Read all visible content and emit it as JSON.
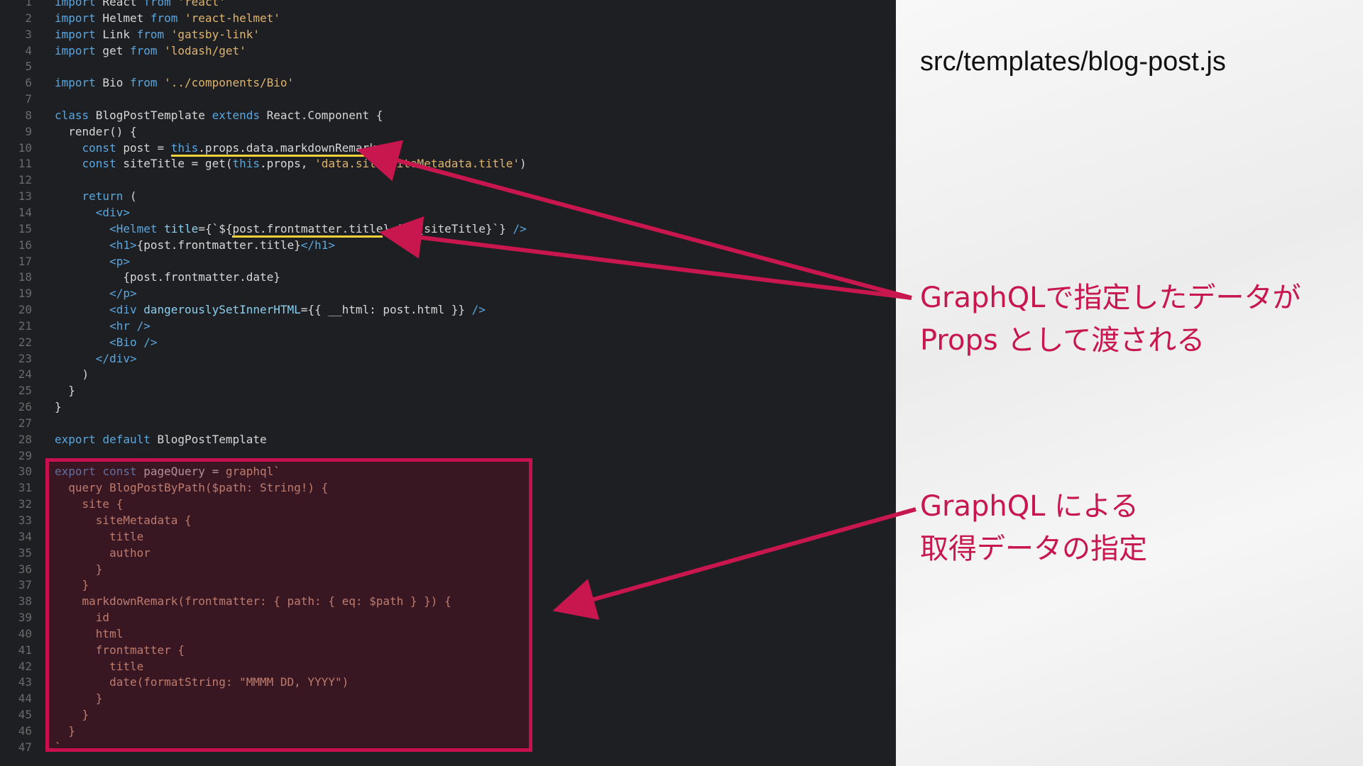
{
  "editor": {
    "lines": [
      {
        "n": "1",
        "html": "<span class=\"kw\">import</span> React <span class=\"kw\">from</span> <span class=\"str\">'react'</span>"
      },
      {
        "n": "2",
        "html": "<span class=\"kw\">import</span> Helmet <span class=\"kw\">from</span> <span class=\"str\">'react-helmet'</span>"
      },
      {
        "n": "3",
        "html": "<span class=\"kw\">import</span> Link <span class=\"kw\">from</span> <span class=\"str\">'gatsby-link'</span>"
      },
      {
        "n": "4",
        "html": "<span class=\"kw\">import</span> get <span class=\"kw\">from</span> <span class=\"str\">'lodash/get'</span>"
      },
      {
        "n": "5",
        "html": ""
      },
      {
        "n": "6",
        "html": "<span class=\"kw\">import</span> Bio <span class=\"kw\">from</span> <span class=\"str\">'../components/Bio'</span>"
      },
      {
        "n": "7",
        "html": ""
      },
      {
        "n": "8",
        "html": "<span class=\"kw\">class</span> BlogPostTemplate <span class=\"kw\">extends</span> React.Component {"
      },
      {
        "n": "9",
        "html": "  render() {"
      },
      {
        "n": "10",
        "html": "    <span class=\"kw\">const</span> post = <span class=\"hl\"><span class=\"kw\">this</span>.props.data.markdownRemark</span>"
      },
      {
        "n": "11",
        "html": "    <span class=\"kw\">const</span> siteTitle = get(<span class=\"kw\">this</span>.props, <span class=\"str\">'data.site.siteMetadata.title'</span>)"
      },
      {
        "n": "12",
        "html": ""
      },
      {
        "n": "13",
        "html": "    <span class=\"kw\">return</span> ("
      },
      {
        "n": "14",
        "html": "      <span class=\"tag\">&lt;div&gt;</span>"
      },
      {
        "n": "15",
        "html": "        <span class=\"tag\">&lt;Helmet</span> <span class=\"attr\">title</span>={`${<span class=\"hl\">post.frontmatter.title</span>} | ${siteTitle}`} <span class=\"tag\">/&gt;</span>"
      },
      {
        "n": "16",
        "html": "        <span class=\"tag\">&lt;h1&gt;</span>{post.frontmatter.title}<span class=\"tag\">&lt;/h1&gt;</span>"
      },
      {
        "n": "17",
        "html": "        <span class=\"tag\">&lt;p&gt;</span>"
      },
      {
        "n": "18",
        "html": "          {post.frontmatter.date}"
      },
      {
        "n": "19",
        "html": "        <span class=\"tag\">&lt;/p&gt;</span>"
      },
      {
        "n": "20",
        "html": "        <span class=\"tag\">&lt;div</span> <span class=\"attr\">dangerouslySetInnerHTML</span>={{ __html: post.html }} <span class=\"tag\">/&gt;</span>"
      },
      {
        "n": "21",
        "html": "        <span class=\"tag\">&lt;hr</span> <span class=\"tag\">/&gt;</span>"
      },
      {
        "n": "22",
        "html": "        <span class=\"tag\">&lt;Bio</span> <span class=\"tag\">/&gt;</span>"
      },
      {
        "n": "23",
        "html": "      <span class=\"tag\">&lt;/div&gt;</span>"
      },
      {
        "n": "24",
        "html": "    )"
      },
      {
        "n": "25",
        "html": "  }"
      },
      {
        "n": "26",
        "html": "}"
      },
      {
        "n": "27",
        "html": ""
      },
      {
        "n": "28",
        "html": "<span class=\"kw\">export</span> <span class=\"kw\">default</span> BlogPostTemplate"
      },
      {
        "n": "29",
        "html": ""
      },
      {
        "n": "30",
        "html": "<span class=\"kw\">export</span> <span class=\"kw\">const</span> pageQuery = <span class=\"gql\">graphql`</span>"
      },
      {
        "n": "31",
        "html": "<span class=\"gql\">  query BlogPostByPath($path: String!) {</span>"
      },
      {
        "n": "32",
        "html": "<span class=\"gql\">    site {</span>"
      },
      {
        "n": "33",
        "html": "<span class=\"gql\">      siteMetadata {</span>"
      },
      {
        "n": "34",
        "html": "<span class=\"gql\">        title</span>"
      },
      {
        "n": "35",
        "html": "<span class=\"gql\">        author</span>"
      },
      {
        "n": "36",
        "html": "<span class=\"gql\">      }</span>"
      },
      {
        "n": "37",
        "html": "<span class=\"gql\">    }</span>"
      },
      {
        "n": "38",
        "html": "<span class=\"gql\">    markdownRemark(frontmatter: { path: { eq: $path } }) {</span>"
      },
      {
        "n": "39",
        "html": "<span class=\"gql\">      id</span>"
      },
      {
        "n": "40",
        "html": "<span class=\"gql\">      html</span>"
      },
      {
        "n": "41",
        "html": "<span class=\"gql\">      frontmatter {</span>"
      },
      {
        "n": "42",
        "html": "<span class=\"gql\">        title</span>"
      },
      {
        "n": "43",
        "html": "<span class=\"gql\">        date(formatString: \"MMMM DD, YYYY\")</span>"
      },
      {
        "n": "44",
        "html": "<span class=\"gql\">      }</span>"
      },
      {
        "n": "45",
        "html": "<span class=\"gql\">    }</span>"
      },
      {
        "n": "46",
        "html": "<span class=\"gql\">  }</span>"
      },
      {
        "n": "47",
        "html": "<span class=\"gql\">`</span>"
      }
    ]
  },
  "panel": {
    "file_title": "src/templates/blog-post.js",
    "note1_line1": "GraphQLで指定したデータが",
    "note1_line2": "Props として渡される",
    "note2_line1": "GraphQL による",
    "note2_line2": "取得データの指定"
  },
  "colors": {
    "accent": "#c8164f",
    "highlight": "#f3d13a",
    "editor_bg": "#1e1f22"
  }
}
